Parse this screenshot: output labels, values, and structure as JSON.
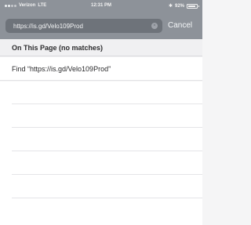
{
  "status_bar": {
    "carrier": "Verizon",
    "network": "LTE",
    "time": "12:31 PM",
    "bluetooth": "✱",
    "battery_percent": "92%",
    "battery_level": 0.92
  },
  "search": {
    "value": "https://is.gd/Velo109Prod",
    "clear_icon": "×",
    "cancel_label": "Cancel"
  },
  "results": {
    "section_title": "On This Page (no matches)",
    "find_label": "Find “https://is.gd/Velo109Prod”"
  },
  "colors": {
    "bar": "#8d9299",
    "search_field": "#6e737a",
    "background": "#ffffff"
  }
}
